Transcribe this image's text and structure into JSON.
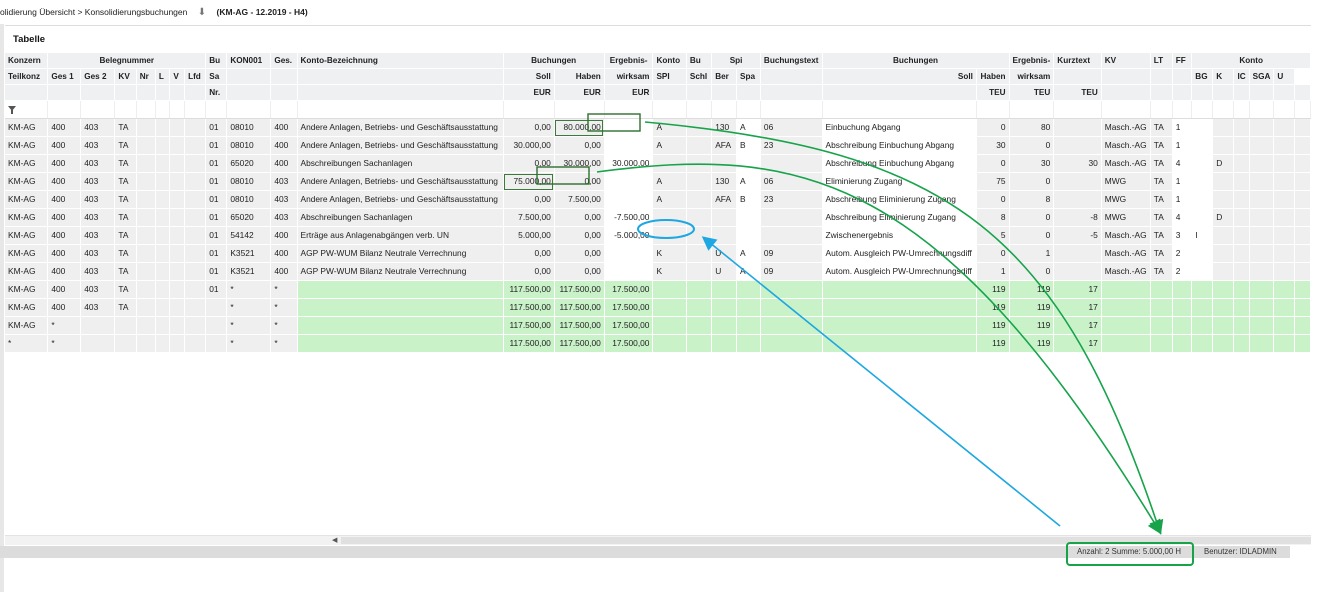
{
  "breadcrumb": {
    "path": "olidierung Übersicht > Konsolidierungsbuchungen",
    "context": "(KM-AG - 12.2019 - H4)"
  },
  "panel": {
    "title": "Tabelle"
  },
  "header": {
    "row1": [
      "Konzern",
      "Belegnummer",
      "Bu",
      "KON001",
      "Ges.",
      "Konto-Bezeichnung",
      "Buchungen",
      "Ergebnis-",
      "Konto",
      "Bu",
      "Spi",
      "Buchungstext",
      "Buchungen",
      "Ergebnis-",
      "Kurztext",
      "KV",
      "LT",
      "FF",
      "Konto"
    ],
    "row2": [
      "Teilkonz",
      "Ges 1",
      "Ges 2",
      "KV",
      "Nr",
      "L",
      "V",
      "Lfd",
      "Sa",
      "Soll",
      "Haben",
      "wirksam",
      "SPI",
      "Schl",
      "Ber",
      "Spa",
      "Soll",
      "Haben",
      "wirksam",
      "BG",
      "K",
      "IC",
      "SGA",
      "U"
    ],
    "row3": [
      "Nr.",
      "EUR",
      "EUR",
      "EUR",
      "TEU",
      "TEU",
      "TEU"
    ]
  },
  "rows": [
    [
      "KM-AG",
      "400",
      "403",
      "TA",
      "01",
      "08010",
      "400",
      "Andere Anlagen, Betriebs- und Geschäftsausstattung",
      "0,00",
      "80.000,00",
      "",
      "A",
      "",
      "130",
      "A",
      "06",
      "Einbuchung Abgang",
      "0",
      "80",
      "",
      "Masch.-AG",
      "TA",
      "1",
      "",
      ""
    ],
    [
      "KM-AG",
      "400",
      "403",
      "TA",
      "01",
      "08010",
      "400",
      "Andere Anlagen, Betriebs- und Geschäftsausstattung",
      "30.000,00",
      "0,00",
      "",
      "A",
      "",
      "AFA",
      "B",
      "23",
      "Abschreibung Einbuchung Abgang",
      "30",
      "0",
      "",
      "Masch.-AG",
      "TA",
      "1",
      "",
      ""
    ],
    [
      "KM-AG",
      "400",
      "403",
      "TA",
      "01",
      "65020",
      "400",
      "Abschreibungen Sachanlagen",
      "0,00",
      "30.000,00",
      "30.000,00",
      "",
      "",
      "",
      "",
      "",
      "Abschreibung Einbuchung Abgang",
      "0",
      "30",
      "30",
      "Masch.-AG",
      "TA",
      "4",
      "",
      "D"
    ],
    [
      "KM-AG",
      "400",
      "403",
      "TA",
      "01",
      "08010",
      "403",
      "Andere Anlagen, Betriebs- und Geschäftsausstattung",
      "75.000,00",
      "0,00",
      "",
      "A",
      "",
      "130",
      "A",
      "06",
      "Eliminierung Zugang",
      "75",
      "0",
      "",
      "MWG",
      "TA",
      "1",
      "",
      ""
    ],
    [
      "KM-AG",
      "400",
      "403",
      "TA",
      "01",
      "08010",
      "403",
      "Andere Anlagen, Betriebs- und Geschäftsausstattung",
      "0,00",
      "7.500,00",
      "",
      "A",
      "",
      "AFA",
      "B",
      "23",
      "Abschreibung Eliminierung Zugang",
      "0",
      "8",
      "",
      "MWG",
      "TA",
      "1",
      "",
      ""
    ],
    [
      "KM-AG",
      "400",
      "403",
      "TA",
      "01",
      "65020",
      "403",
      "Abschreibungen Sachanlagen",
      "7.500,00",
      "0,00",
      "-7.500,00",
      "",
      "",
      "",
      "",
      "",
      "Abschreibung Eliminierung Zugang",
      "8",
      "0",
      "-8",
      "MWG",
      "TA",
      "4",
      "",
      "D"
    ],
    [
      "KM-AG",
      "400",
      "403",
      "TA",
      "01",
      "54142",
      "400",
      "Erträge aus Anlagenabgängen verb. UN",
      "5.000,00",
      "0,00",
      "-5.000,00",
      "",
      "",
      "",
      "",
      "",
      "Zwischenergebnis",
      "5",
      "0",
      "-5",
      "Masch.-AG",
      "TA",
      "3",
      "I",
      ""
    ],
    [
      "KM-AG",
      "400",
      "403",
      "TA",
      "01",
      "K3521",
      "400",
      "AGP PW-WUM Bilanz Neutrale Verrechnung",
      "0,00",
      "0,00",
      "",
      "K",
      "",
      "U",
      "A",
      "09",
      "Autom. Ausgleich PW-Umrechnungsdiff",
      "0",
      "1",
      "",
      "Masch.-AG",
      "TA",
      "2",
      "",
      ""
    ],
    [
      "KM-AG",
      "400",
      "403",
      "TA",
      "01",
      "K3521",
      "400",
      "AGP PW-WUM Bilanz Neutrale Verrechnung",
      "0,00",
      "0,00",
      "",
      "K",
      "",
      "U",
      "A",
      "09",
      "Autom. Ausgleich PW-Umrechnungsdiff",
      "1",
      "0",
      "",
      "Masch.-AG",
      "TA",
      "2",
      "",
      ""
    ]
  ],
  "sum_rows": [
    [
      "KM-AG",
      "400",
      "403",
      "TA",
      "01",
      "*",
      "*",
      "117.500,00",
      "117.500,00",
      "17.500,00",
      "119",
      "119",
      "17"
    ],
    [
      "KM-AG",
      "400",
      "403",
      "TA",
      "",
      "*",
      "*",
      "117.500,00",
      "117.500,00",
      "17.500,00",
      "119",
      "119",
      "17"
    ],
    [
      "KM-AG",
      "*",
      "",
      "",
      "",
      "*",
      "*",
      "117.500,00",
      "117.500,00",
      "17.500,00",
      "119",
      "119",
      "17"
    ],
    [
      "*",
      "*",
      "",
      "",
      "",
      "*",
      "*",
      "117.500,00",
      "117.500,00",
      "17.500,00",
      "119",
      "119",
      "17"
    ]
  ],
  "status": {
    "summary": "Anzahl: 2 Summe: 5.000,00 H",
    "user": "Benutzer: IDLADMIN"
  },
  "colors": {
    "annotation_green": "#16a34a",
    "annotation_blue": "#1ea7e1",
    "sum_row_bg": "#c9f2c9"
  },
  "icons": {
    "filter": "filter-icon",
    "download": "download-arrow-icon"
  }
}
